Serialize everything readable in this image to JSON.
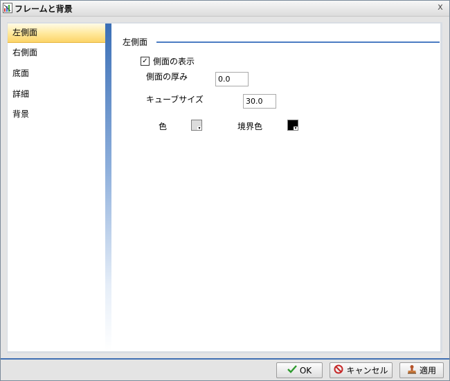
{
  "window": {
    "title": "フレームと背景",
    "close_glyph": "x"
  },
  "sidebar": {
    "items": [
      {
        "label": "左側面",
        "selected": true
      },
      {
        "label": "右側面",
        "selected": false
      },
      {
        "label": "底面",
        "selected": false
      },
      {
        "label": "詳細",
        "selected": false
      },
      {
        "label": "背景",
        "selected": false
      }
    ]
  },
  "panel": {
    "title": "左側面",
    "show_side": {
      "label": "側面の表示",
      "checked": true,
      "check_glyph": "✓"
    },
    "thickness": {
      "label": "側面の厚み",
      "value": "0.0"
    },
    "cube_size": {
      "label": "キューブサイズ",
      "value": "30.0"
    },
    "color": {
      "label": "色",
      "value": "#dcdcdc"
    },
    "border_color": {
      "label": "境界色",
      "value": "#000000"
    }
  },
  "buttons": {
    "ok": "OK",
    "cancel": "キャンセル",
    "apply": "適用"
  },
  "theme": {
    "accent": "#4a7bc2",
    "selected_item": "#ffe89a"
  }
}
